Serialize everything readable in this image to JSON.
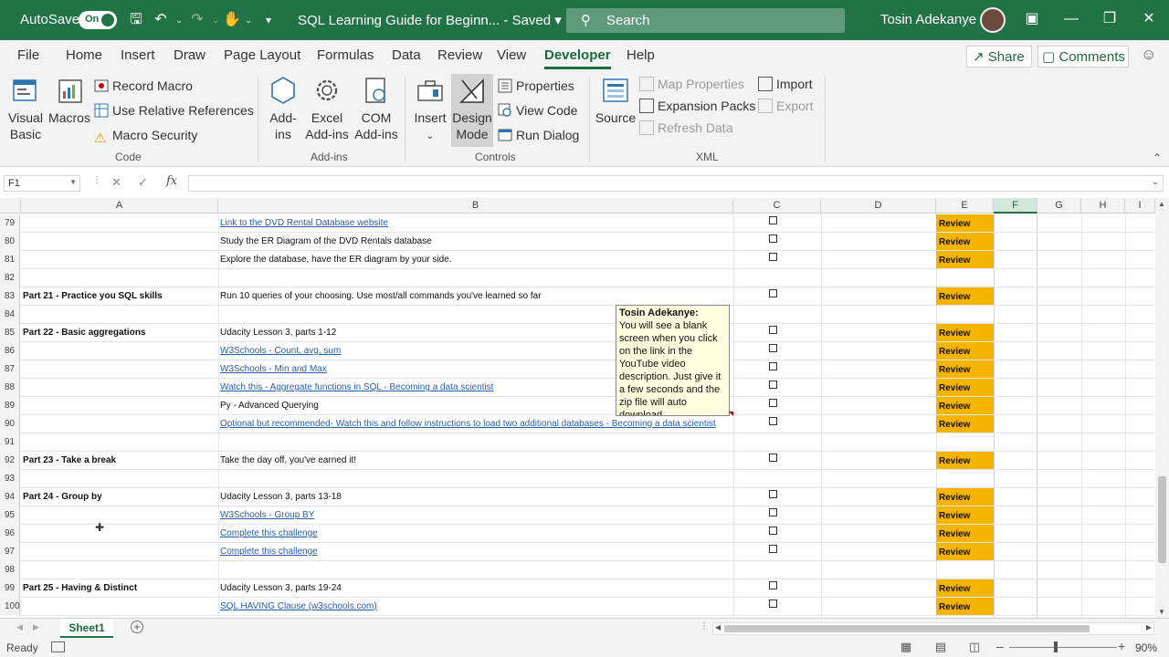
{
  "titlebar": {
    "autosave_label": "AutoSave",
    "autosave_state": "On",
    "doc_title": "SQL Learning Guide for Beginn...  -  Saved",
    "search_placeholder": "Search",
    "user_name": "Tosin Adekanye",
    "accent_color": "#217346"
  },
  "menu": {
    "tabs": [
      "File",
      "Home",
      "Insert",
      "Draw",
      "Page Layout",
      "Formulas",
      "Data",
      "Review",
      "View",
      "Developer",
      "Help"
    ],
    "active_tab": "Developer",
    "share_label": "Share",
    "comments_label": "Comments"
  },
  "ribbon": {
    "code": {
      "group_label": "Code",
      "visual_basic": "Visual Basic",
      "macros": "Macros",
      "record_macro": "Record Macro",
      "use_relative": "Use Relative References",
      "macro_security": "Macro Security"
    },
    "addins": {
      "group_label": "Add-ins",
      "addins": "Add- ins",
      "excel_addins": "Excel Add-ins",
      "com_addins": "COM Add-ins"
    },
    "controls": {
      "group_label": "Controls",
      "insert": "Insert",
      "design_mode": "Design Mode",
      "properties": "Properties",
      "view_code": "View Code",
      "run_dialog": "Run Dialog"
    },
    "xml": {
      "group_label": "XML",
      "source": "Source",
      "map_properties": "Map Properties",
      "expansion_packs": "Expansion Packs",
      "refresh_data": "Refresh Data",
      "import": "Import",
      "export": "Export"
    }
  },
  "formula_bar": {
    "name_box": "F1",
    "fx": "fx",
    "value": ""
  },
  "columns": [
    "A",
    "B",
    "C",
    "D",
    "E",
    "F",
    "G",
    "H",
    "I"
  ],
  "selected_column": "F",
  "rows": [
    {
      "n": "79",
      "a": "",
      "b": "Link to the DVD Rental Database website",
      "link": true,
      "check": true,
      "review": true
    },
    {
      "n": "80",
      "a": "",
      "b": "Study the ER Diagram of the DVD Rentals database",
      "link": false,
      "check": true,
      "review": true
    },
    {
      "n": "81",
      "a": "",
      "b": "Explore the database, have the ER diagram by your side.",
      "link": false,
      "check": true,
      "review": true
    },
    {
      "n": "82",
      "a": "",
      "b": "",
      "link": false,
      "check": false,
      "review": false
    },
    {
      "n": "83",
      "a": "Part 21 - Practice you SQL skills",
      "b": "Run 10 queries of your choosing. Use most/all commands you've learned so far",
      "link": false,
      "check": true,
      "review": true
    },
    {
      "n": "84",
      "a": "",
      "b": "",
      "link": false,
      "check": false,
      "review": false
    },
    {
      "n": "85",
      "a": "Part 22 - Basic aggregations",
      "b": "Udacity Lesson 3, parts 1-12",
      "link": false,
      "check": true,
      "review": true
    },
    {
      "n": "86",
      "a": "",
      "b": "W3Schools - Count, avg, sum",
      "link": true,
      "check": true,
      "review": true
    },
    {
      "n": "87",
      "a": "",
      "b": "W3Schools - Min and Max",
      "link": true,
      "check": true,
      "review": true
    },
    {
      "n": "88",
      "a": "",
      "b": "Watch this - Aggregate functions in SQL - Becoming a data scientist",
      "link": true,
      "check": true,
      "review": true
    },
    {
      "n": "89",
      "a": "",
      "b": "Py - Advanced Querying",
      "link": false,
      "check": true,
      "review": true
    },
    {
      "n": "90",
      "a": "",
      "b": "Optional but recommended- Watch this and follow instructions to load two additional databases - Becoming a data scientist",
      "link": true,
      "check": true,
      "review": true
    },
    {
      "n": "91",
      "a": "",
      "b": "",
      "link": false,
      "check": false,
      "review": false
    },
    {
      "n": "92",
      "a": "Part 23 - Take a break",
      "b": "Take the day off, you've earned it!",
      "link": false,
      "check": true,
      "review": true
    },
    {
      "n": "93",
      "a": "",
      "b": "",
      "link": false,
      "check": false,
      "review": false
    },
    {
      "n": "94",
      "a": "Part 24 - Group by",
      "b": "Udacity Lesson 3, parts 13-18",
      "link": false,
      "check": true,
      "review": true
    },
    {
      "n": "95",
      "a": "",
      "b": "W3Schools - Group BY",
      "link": true,
      "check": true,
      "review": true
    },
    {
      "n": "96",
      "a": "",
      "b": "Complete this challenge",
      "link": true,
      "check": true,
      "review": true
    },
    {
      "n": "97",
      "a": "",
      "b": "Complete this challenge",
      "link": true,
      "check": true,
      "review": true
    },
    {
      "n": "98",
      "a": "",
      "b": "",
      "link": false,
      "check": false,
      "review": false
    },
    {
      "n": "99",
      "a": "Part 25 - Having & Distinct",
      "b": "Udacity Lesson 3, parts 19-24",
      "link": false,
      "check": true,
      "review": true
    },
    {
      "n": "100",
      "a": "",
      "b": "SQL HAVING Clause (w3schools.com)",
      "link": true,
      "check": true,
      "review": true
    }
  ],
  "review_label": "Review",
  "review_color": "#f4b400",
  "comment": {
    "author": "Tosin Adekanye:",
    "text": "You will see a blank screen when you click on the link in the YouTube video description. Just give it a few seconds and the zip file will auto download"
  },
  "sheets": [
    "Sheet1"
  ],
  "status": {
    "ready": "Ready",
    "zoom": "90%"
  }
}
